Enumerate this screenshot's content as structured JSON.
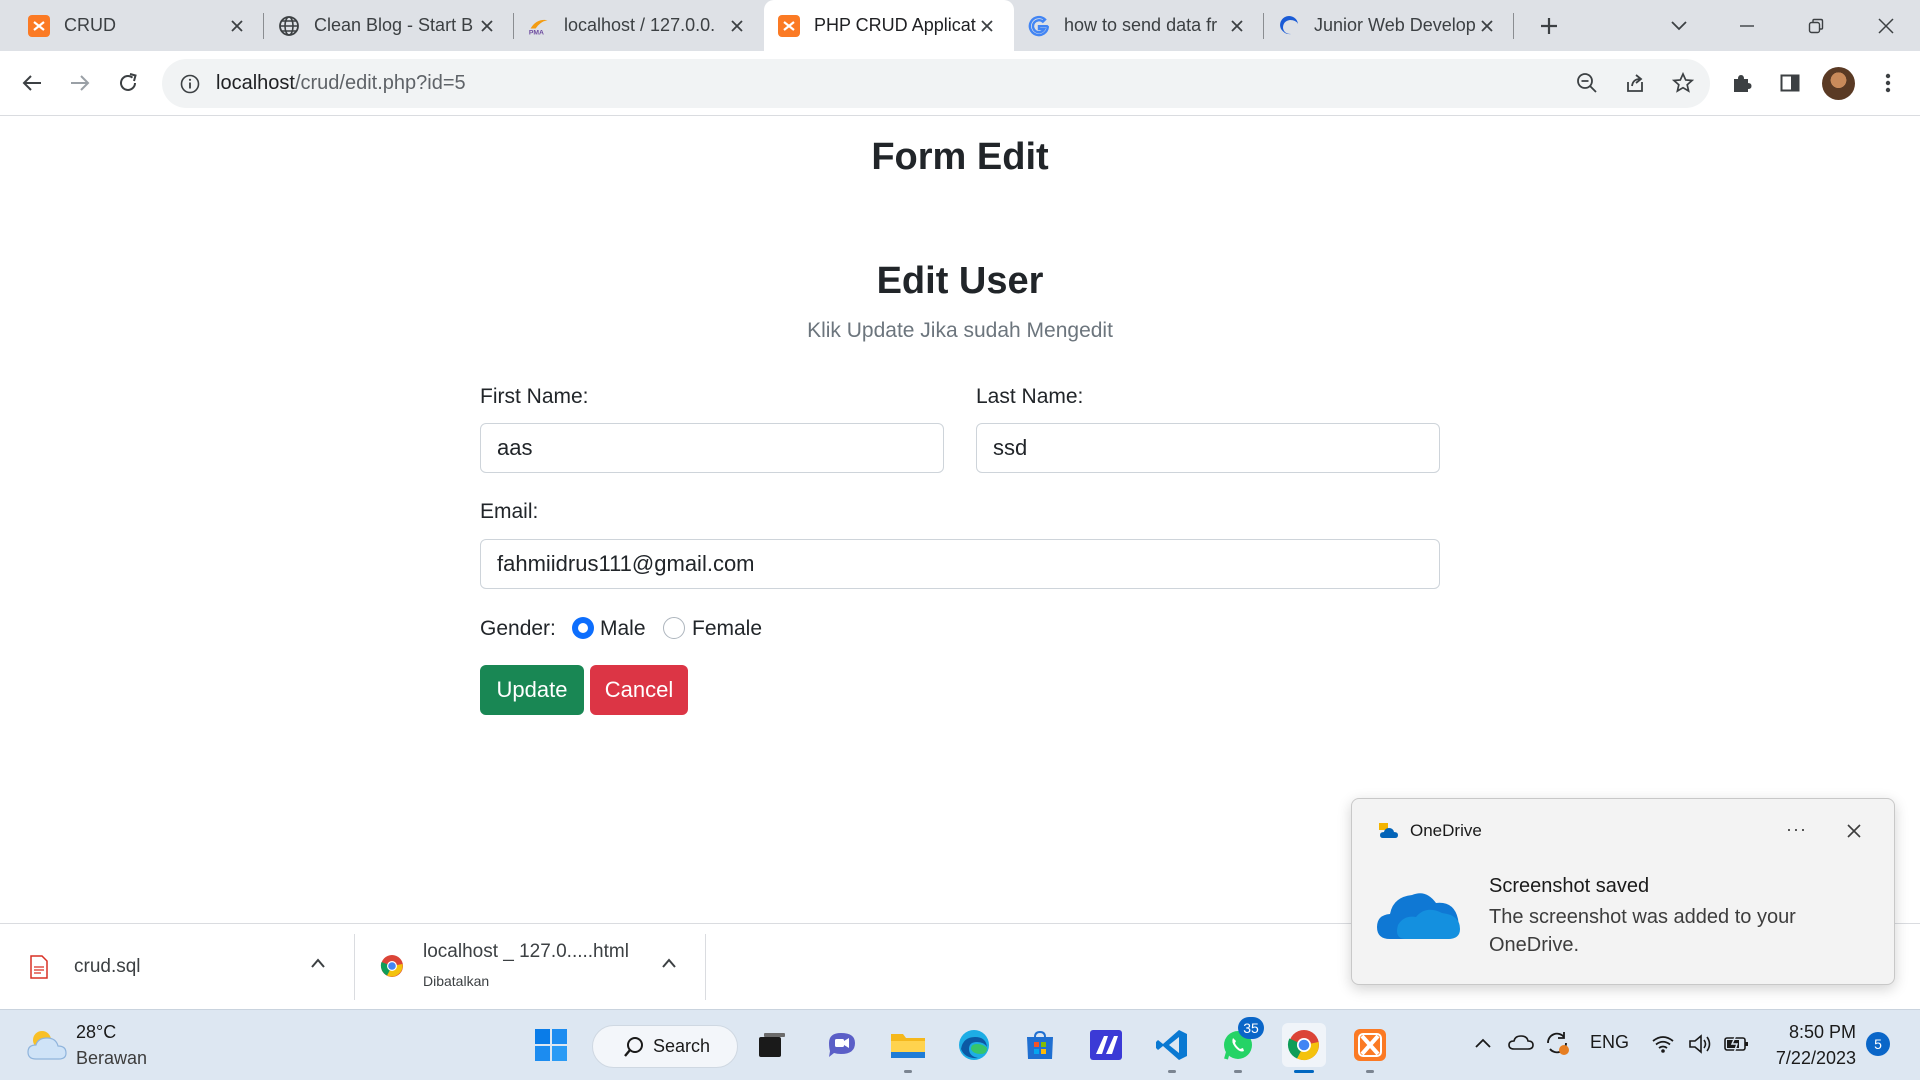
{
  "browser": {
    "tabs": [
      {
        "title": "CRUD",
        "icon": "xampp-icon",
        "active": false
      },
      {
        "title": "Clean Blog - Start B",
        "icon": "globe-icon",
        "active": false
      },
      {
        "title": "localhost / 127.0.0.",
        "icon": "phpmyadmin-icon",
        "active": false
      },
      {
        "title": "PHP CRUD Applicat",
        "icon": "xampp-icon",
        "active": true
      },
      {
        "title": "how to send data fr",
        "icon": "google-icon",
        "active": false
      },
      {
        "title": "Junior Web Develop",
        "icon": "edge-like-icon",
        "active": false
      }
    ],
    "url_host": "localhost",
    "url_path": "/crud/edit.php?id=5"
  },
  "page": {
    "title": "Form Edit",
    "card_title": "Edit User",
    "card_subtitle": "Klik Update Jika sudah Mengedit",
    "form": {
      "first_name_label": "First Name:",
      "first_name_value": "aas",
      "last_name_label": "Last Name:",
      "last_name_value": "ssd",
      "email_label": "Email:",
      "email_value": "fahmiidrus111@gmail.com",
      "gender_label": "Gender:",
      "gender_options": [
        "Male",
        "Female"
      ],
      "gender_selected": "Male",
      "update_label": "Update",
      "cancel_label": "Cancel"
    }
  },
  "downloads": [
    {
      "name": "crud.sql",
      "status": ""
    },
    {
      "name": "localhost _ 127.0.....html",
      "status": "Dibatalkan"
    }
  ],
  "notification": {
    "app": "OneDrive",
    "heading": "Screenshot saved",
    "body": "The screenshot was added to your OneDrive."
  },
  "taskbar": {
    "weather_temp": "28°C",
    "weather_desc": "Berawan",
    "search_label": "Search",
    "whatsapp_badge": "35",
    "language": "ENG",
    "time": "8:50 PM",
    "date": "7/22/2023",
    "notification_count": "5"
  },
  "colors": {
    "update_button": "#198754",
    "cancel_button": "#dc3545",
    "radio_checked": "#0d6efd",
    "tab_strip": "#dee1e6",
    "taskbar": "#dde7f2"
  }
}
